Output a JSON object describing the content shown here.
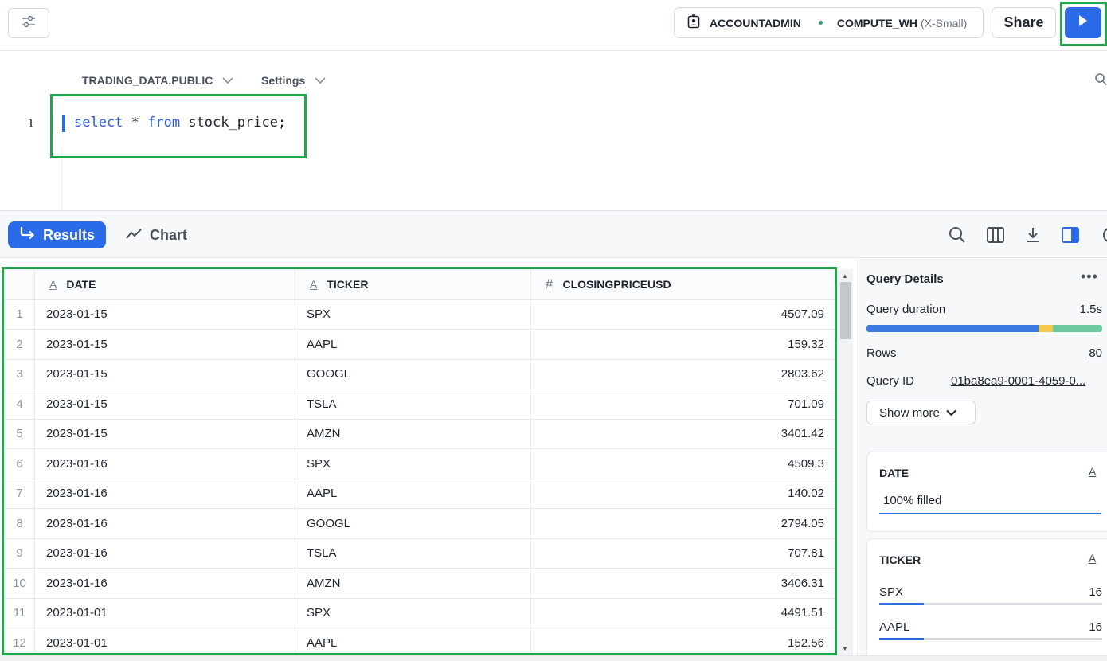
{
  "topbar": {
    "role": "ACCOUNTADMIN",
    "warehouse": "COMPUTE_WH",
    "warehouse_size": "(X-Small)",
    "share_label": "Share"
  },
  "editor": {
    "database": "TRADING_DATA.PUBLIC",
    "settings_label": "Settings",
    "line_number": "1",
    "code_kw1": "select",
    "code_mid": " * ",
    "code_kw2": "from",
    "code_rest": " stock_price;"
  },
  "results": {
    "results_tab": "Results",
    "chart_tab": "Chart"
  },
  "table": {
    "columns": [
      {
        "type_icon": "A",
        "name": "DATE"
      },
      {
        "type_icon": "A",
        "name": "TICKER"
      },
      {
        "type_icon": "#",
        "name": "CLOSINGPRICEUSD"
      }
    ],
    "rows": [
      {
        "n": "1",
        "date": "2023-01-15",
        "ticker": "SPX",
        "price": "4507.09"
      },
      {
        "n": "2",
        "date": "2023-01-15",
        "ticker": "AAPL",
        "price": "159.32"
      },
      {
        "n": "3",
        "date": "2023-01-15",
        "ticker": "GOOGL",
        "price": "2803.62"
      },
      {
        "n": "4",
        "date": "2023-01-15",
        "ticker": "TSLA",
        "price": "701.09"
      },
      {
        "n": "5",
        "date": "2023-01-15",
        "ticker": "AMZN",
        "price": "3401.42"
      },
      {
        "n": "6",
        "date": "2023-01-16",
        "ticker": "SPX",
        "price": "4509.3"
      },
      {
        "n": "7",
        "date": "2023-01-16",
        "ticker": "AAPL",
        "price": "140.02"
      },
      {
        "n": "8",
        "date": "2023-01-16",
        "ticker": "GOOGL",
        "price": "2794.05"
      },
      {
        "n": "9",
        "date": "2023-01-16",
        "ticker": "TSLA",
        "price": "707.81"
      },
      {
        "n": "10",
        "date": "2023-01-16",
        "ticker": "AMZN",
        "price": "3406.31"
      },
      {
        "n": "11",
        "date": "2023-01-01",
        "ticker": "SPX",
        "price": "4491.51"
      },
      {
        "n": "12",
        "date": "2023-01-01",
        "ticker": "AAPL",
        "price": "152.56"
      }
    ]
  },
  "details": {
    "title": "Query Details",
    "more": "•••",
    "duration_label": "Query duration",
    "duration_value": "1.5s",
    "duration_segments": [
      {
        "fraction": 0.73,
        "color": "#3b7ae0"
      },
      {
        "fraction": 0.06,
        "color": "#f2c94c"
      },
      {
        "fraction": 0.21,
        "color": "#6cc9a0"
      }
    ],
    "rows_label": "Rows",
    "rows_value": "80",
    "query_id_label": "Query ID",
    "query_id_value": "01ba8ea9-0001-4059-0...",
    "show_more": "Show more",
    "date_card": {
      "name": "DATE",
      "type": "A",
      "fill_text": "100% filled",
      "fill_fraction": 1.0
    },
    "ticker_card": {
      "name": "TICKER",
      "type": "A",
      "values": [
        {
          "label": "SPX",
          "count": "16",
          "fraction": 0.2
        },
        {
          "label": "AAPL",
          "count": "16",
          "fraction": 0.2
        }
      ]
    }
  },
  "colors": {
    "accent": "#2b6be8",
    "highlight_frame": "#1ea84d"
  }
}
